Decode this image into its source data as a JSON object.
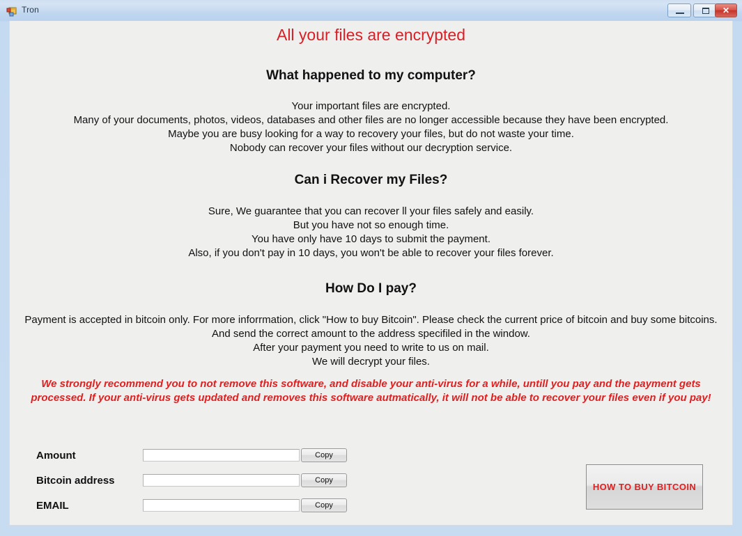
{
  "window": {
    "title": "Tron",
    "icon": "winforms-icon",
    "controls": {
      "minimize": "minimize",
      "maximize": "maximize",
      "close": "✕"
    }
  },
  "content": {
    "main_heading": "All your files are encrypted",
    "sections": [
      {
        "heading": "What happened to my computer?",
        "lines": [
          "Your important files are encrypted.",
          "Many of your documents, photos, videos, databases and other files are no longer accessible because they have been encrypted.",
          "Maybe you are busy looking for a way to recovery your files, but do not waste your time.",
          "Nobody can recover your files without our decryption service."
        ]
      },
      {
        "heading": "Can i Recover my Files?",
        "lines": [
          "Sure, We guarantee that you can recover ll your files safely and easily.",
          "But you have not so enough time.",
          "You have only have 10 days to submit the payment.",
          "Also, if you don't pay in 10 days, you won't be able to recover your files forever."
        ]
      },
      {
        "heading": "How Do I pay?",
        "lines": [
          "Payment is accepted in bitcoin only. For more inforrmation, click \"How to buy Bitcoin\". Please check the current price of bitcoin and buy some bitcoins.",
          "And send the correct amount to the address specifiled in the window.",
          "After your payment you need to write to us on mail.",
          "We will decrypt your files."
        ]
      }
    ],
    "warning": "We strongly recommend you to not remove this software, and disable your anti-virus for a while, untill you pay and the payment gets processed. If your anti-virus gets updated and removes this software autmatically, it will not be able to recover your files even if you pay!"
  },
  "form": {
    "rows": [
      {
        "label": "Amount",
        "value": "",
        "placeholder": "",
        "button": "Copy"
      },
      {
        "label": "Bitcoin address",
        "value": "",
        "placeholder": "",
        "button": "Copy"
      },
      {
        "label": "EMAIL",
        "value": "",
        "placeholder": "",
        "button": "Copy"
      }
    ],
    "bitcoin_button": "HOW TO BUY\nBITCOIN"
  },
  "colors": {
    "accent_red": "#d81f26",
    "warning_red": "#e02020",
    "client_bg": "#efefee",
    "frame_blue": "#c8dcf1"
  }
}
